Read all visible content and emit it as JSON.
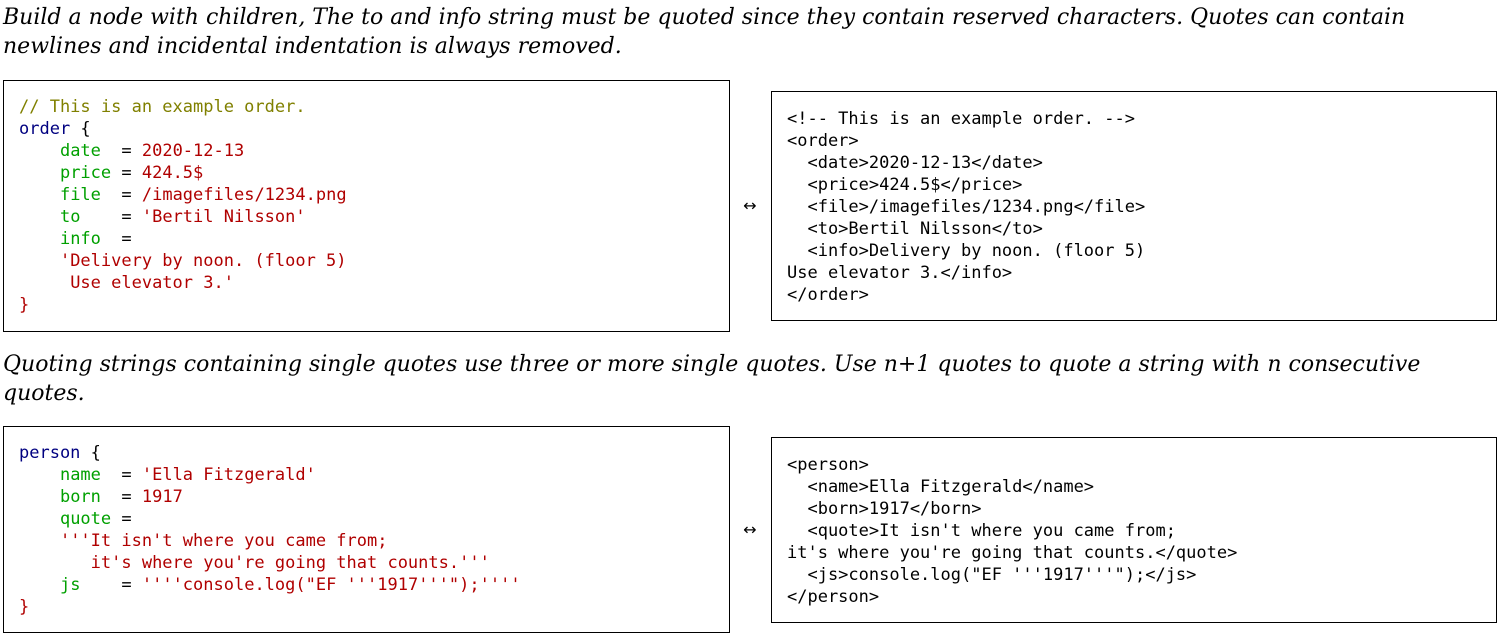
{
  "section1": {
    "description": "Build a node with children, The to and info string must be quoted since they contain reserved characters. Quotes can contain newlines and incidental indentation is always removed.",
    "arrow": "↔",
    "source": [
      [
        {
          "t": "// This is an example order.",
          "c": "comment"
        }
      ],
      [
        {
          "t": "order",
          "c": "node"
        },
        {
          "t": " {",
          "c": "punc"
        }
      ],
      [
        {
          "t": "    ",
          "c": "punc"
        },
        {
          "t": "date",
          "c": "key"
        },
        {
          "t": "  = ",
          "c": "punc"
        },
        {
          "t": "2020-12-13",
          "c": "val"
        }
      ],
      [
        {
          "t": "    ",
          "c": "punc"
        },
        {
          "t": "price",
          "c": "key"
        },
        {
          "t": " = ",
          "c": "punc"
        },
        {
          "t": "424.5$",
          "c": "val"
        }
      ],
      [
        {
          "t": "    ",
          "c": "punc"
        },
        {
          "t": "file",
          "c": "key"
        },
        {
          "t": "  = ",
          "c": "punc"
        },
        {
          "t": "/imagefiles/1234.png",
          "c": "val"
        }
      ],
      [
        {
          "t": "    ",
          "c": "punc"
        },
        {
          "t": "to",
          "c": "key"
        },
        {
          "t": "    = ",
          "c": "punc"
        },
        {
          "t": "'Bertil Nilsson'",
          "c": "val"
        }
      ],
      [
        {
          "t": "    ",
          "c": "punc"
        },
        {
          "t": "info",
          "c": "key"
        },
        {
          "t": "  =",
          "c": "punc"
        }
      ],
      [
        {
          "t": "    ",
          "c": "punc"
        },
        {
          "t": "'Delivery by noon. (floor 5)",
          "c": "val"
        }
      ],
      [
        {
          "t": "     ",
          "c": "punc"
        },
        {
          "t": "Use elevator 3.'",
          "c": "val"
        }
      ],
      [
        {
          "t": "}",
          "c": "val"
        }
      ]
    ],
    "xml": [
      "<!-- This is an example order. -->",
      "<order>",
      "  <date>2020-12-13</date>",
      "  <price>424.5$</price>",
      "  <file>/imagefiles/1234.png</file>",
      "  <to>Bertil Nilsson</to>",
      "  <info>Delivery by noon. (floor 5)",
      "Use elevator 3.</info>",
      "</order>"
    ]
  },
  "section2": {
    "description": "Quoting strings containing single quotes use three or more single quotes. Use n+1 quotes to quote a string with n consecutive quotes.",
    "arrow": "↔",
    "source": [
      [
        {
          "t": "person",
          "c": "node"
        },
        {
          "t": " {",
          "c": "punc"
        }
      ],
      [
        {
          "t": "    ",
          "c": "punc"
        },
        {
          "t": "name",
          "c": "key"
        },
        {
          "t": "  = ",
          "c": "punc"
        },
        {
          "t": "'Ella Fitzgerald'",
          "c": "val"
        }
      ],
      [
        {
          "t": "    ",
          "c": "punc"
        },
        {
          "t": "born",
          "c": "key"
        },
        {
          "t": "  = ",
          "c": "punc"
        },
        {
          "t": "1917",
          "c": "val"
        }
      ],
      [
        {
          "t": "    ",
          "c": "punc"
        },
        {
          "t": "quote",
          "c": "key"
        },
        {
          "t": " =",
          "c": "punc"
        }
      ],
      [
        {
          "t": "    ",
          "c": "punc"
        },
        {
          "t": "'''It isn't where you came from;",
          "c": "val"
        }
      ],
      [
        {
          "t": "       ",
          "c": "punc"
        },
        {
          "t": "it's where you're going that counts.'''",
          "c": "val"
        }
      ],
      [
        {
          "t": "    ",
          "c": "punc"
        },
        {
          "t": "js",
          "c": "key"
        },
        {
          "t": "    = ",
          "c": "punc"
        },
        {
          "t": "''''console.log(\"EF '''1917'''\");''''",
          "c": "val"
        }
      ],
      [
        {
          "t": "}",
          "c": "val"
        }
      ]
    ],
    "xml": [
      "<person>",
      "  <name>Ella Fitzgerald</name>",
      "  <born>1917</born>",
      "  <quote>It isn't where you came from;",
      "it's where you're going that counts.</quote>",
      "  <js>console.log(\"EF '''1917'''\");</js>",
      "</person>"
    ]
  }
}
